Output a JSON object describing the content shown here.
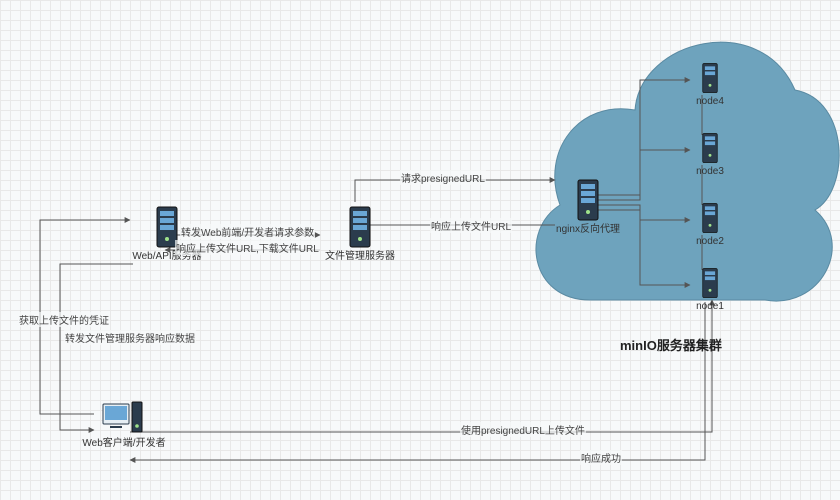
{
  "cluster_title": "minIO服务器集群",
  "nodes": {
    "web_api": "Web/API服务器",
    "file_mgr": "文件管理服务器",
    "nginx": "nginx反向代理",
    "client": "Web客户端/开发者",
    "node1": "node1",
    "node2": "node2",
    "node3": "node3",
    "node4": "node4"
  },
  "edges": {
    "get_token": "获取上传文件的凭证",
    "fwd_file_mgr_resp": "转发文件管理服务器响应数据",
    "fwd_web_req": "转发Web前端/开发者请求参数",
    "resp_urls": "响应上传文件URL,下载文件URL",
    "req_presigned": "请求presignedURL",
    "resp_upload_url": "响应上传文件URL",
    "use_presigned_upload": "使用presignedURL上传文件",
    "resp_success": "响应成功"
  },
  "chart_data": {
    "type": "diagram",
    "title": "minIO服务器集群",
    "nodes": [
      {
        "id": "client",
        "label": "Web客户端/开发者",
        "kind": "pc"
      },
      {
        "id": "web_api",
        "label": "Web/API服务器",
        "kind": "server"
      },
      {
        "id": "file_mgr",
        "label": "文件管理服务器",
        "kind": "server"
      },
      {
        "id": "nginx",
        "label": "nginx反向代理",
        "kind": "server"
      },
      {
        "id": "node1",
        "label": "node1",
        "kind": "server",
        "group": "minIO"
      },
      {
        "id": "node2",
        "label": "node2",
        "kind": "server",
        "group": "minIO"
      },
      {
        "id": "node3",
        "label": "node3",
        "kind": "server",
        "group": "minIO"
      },
      {
        "id": "node4",
        "label": "node4",
        "kind": "server",
        "group": "minIO"
      }
    ],
    "edges": [
      {
        "from": "client",
        "to": "web_api",
        "label": "获取上传文件的凭证"
      },
      {
        "from": "web_api",
        "to": "client",
        "label": "转发文件管理服务器响应数据"
      },
      {
        "from": "web_api",
        "to": "file_mgr",
        "label": "转发Web前端/开发者请求参数"
      },
      {
        "from": "file_mgr",
        "to": "web_api",
        "label": "响应上传文件URL,下载文件URL"
      },
      {
        "from": "file_mgr",
        "to": "nginx",
        "label": "请求presignedURL"
      },
      {
        "from": "nginx",
        "to": "file_mgr",
        "label": "响应上传文件URL"
      },
      {
        "from": "nginx",
        "to": "node1",
        "label": ""
      },
      {
        "from": "nginx",
        "to": "node2",
        "label": ""
      },
      {
        "from": "nginx",
        "to": "node3",
        "label": ""
      },
      {
        "from": "nginx",
        "to": "node4",
        "label": ""
      },
      {
        "from": "client",
        "to": "node1",
        "label": "使用presignedURL上传文件"
      },
      {
        "from": "node1",
        "to": "client",
        "label": "响应成功"
      }
    ],
    "groups": [
      {
        "id": "minIO",
        "label": "minIO服务器集群",
        "shape": "cloud"
      }
    ]
  }
}
